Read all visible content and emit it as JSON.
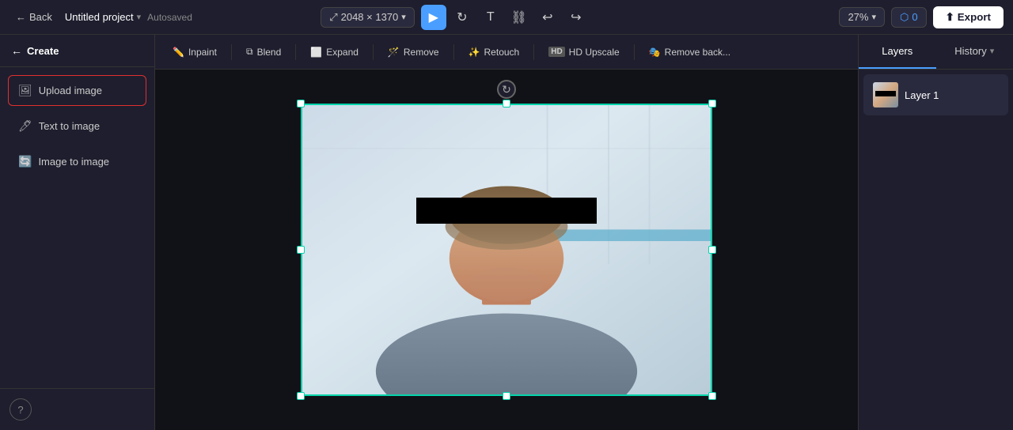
{
  "topbar": {
    "back_label": "Back",
    "project_name": "Untitled project",
    "autosaved_label": "Autosaved",
    "canvas_size": "2048 × 1370",
    "zoom": "27%",
    "credits": "0",
    "export_label": "Export"
  },
  "toolbar": {
    "inpaint_label": "Inpaint",
    "blend_label": "Blend",
    "expand_label": "Expand",
    "remove_label": "Remove",
    "retouch_label": "Retouch",
    "hd_upscale_label": "HD Upscale",
    "remove_back_label": "Remove back..."
  },
  "sidebar": {
    "create_label": "Create",
    "items": [
      {
        "id": "upload-image",
        "label": "Upload image",
        "active": true
      },
      {
        "id": "text-to-image",
        "label": "Text to image",
        "active": false
      },
      {
        "id": "image-to-image",
        "label": "Image to image",
        "active": false
      }
    ]
  },
  "right_panel": {
    "layers_label": "Layers",
    "history_label": "History",
    "layer1_name": "Layer 1"
  }
}
